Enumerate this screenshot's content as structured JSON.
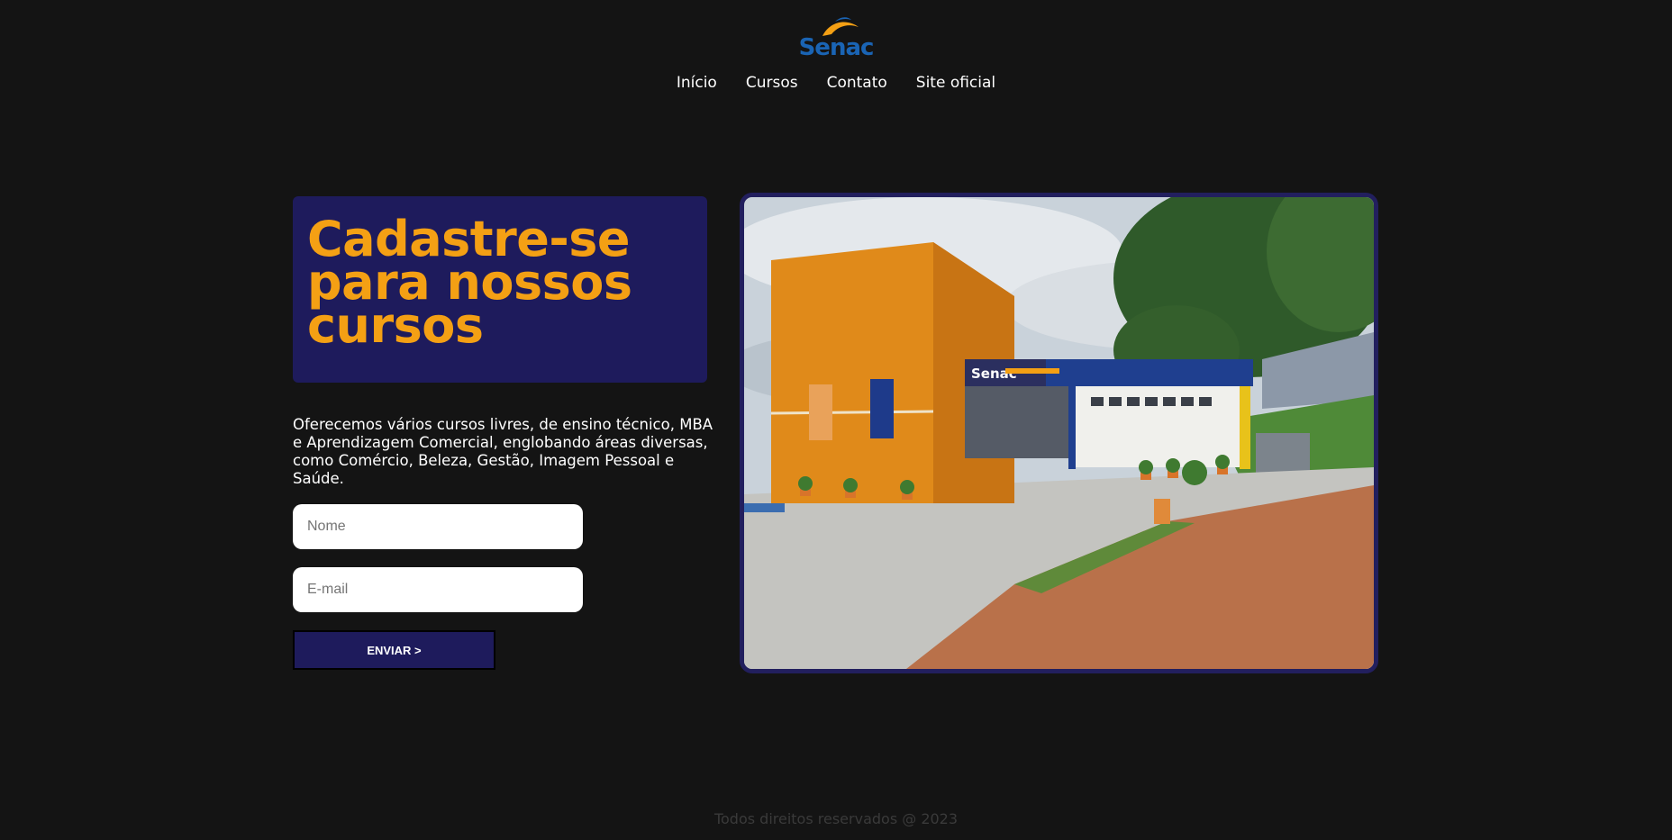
{
  "header": {
    "logo_text": "Senac",
    "nav": [
      "Início",
      "Cursos",
      "Contato",
      "Site oficial"
    ]
  },
  "hero": {
    "title_lines": [
      "Cadastre-se",
      "para nossos",
      "cursos"
    ],
    "description": "Oferecemos vários cursos livres, de ensino técnico, MBA e Aprendizagem Comercial, englobando áreas diversas, como Comércio, Beleza, Gestão, Imagem Pessoal e Saúde."
  },
  "form": {
    "name_placeholder": "Nome",
    "email_placeholder": "E-mail",
    "submit_label": "ENVIAR >"
  },
  "photo": {
    "sign_text": "Senac"
  },
  "footer": {
    "copyright": "Todos direitos reservados @ 2023"
  },
  "colors": {
    "background": "#141414",
    "accent_navy": "#1e1b5c",
    "accent_orange": "#f4a014",
    "logo_blue": "#1a64b4"
  }
}
